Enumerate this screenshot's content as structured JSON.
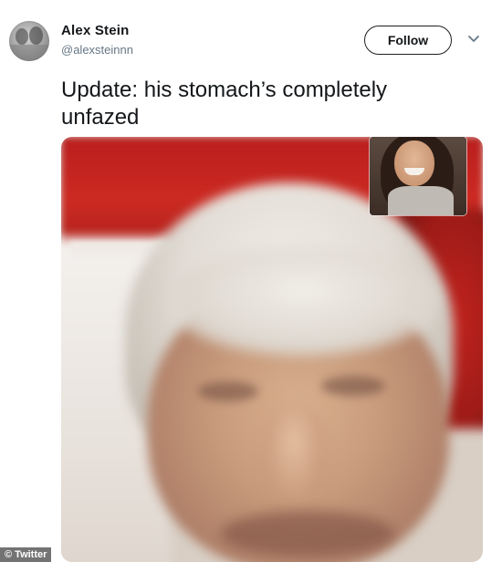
{
  "author": {
    "display_name": "Alex Stein",
    "handle": "@alexsteinnn"
  },
  "actions": {
    "follow_label": "Follow",
    "menu_icon": "chevron-down-icon"
  },
  "tweet": {
    "text": "Update: his stomach’s completely unfazed"
  },
  "watermark": {
    "label": "© Twitter"
  },
  "colors": {
    "text_primary": "#14171a",
    "text_secondary": "#657786",
    "follow_border": "#202020"
  }
}
